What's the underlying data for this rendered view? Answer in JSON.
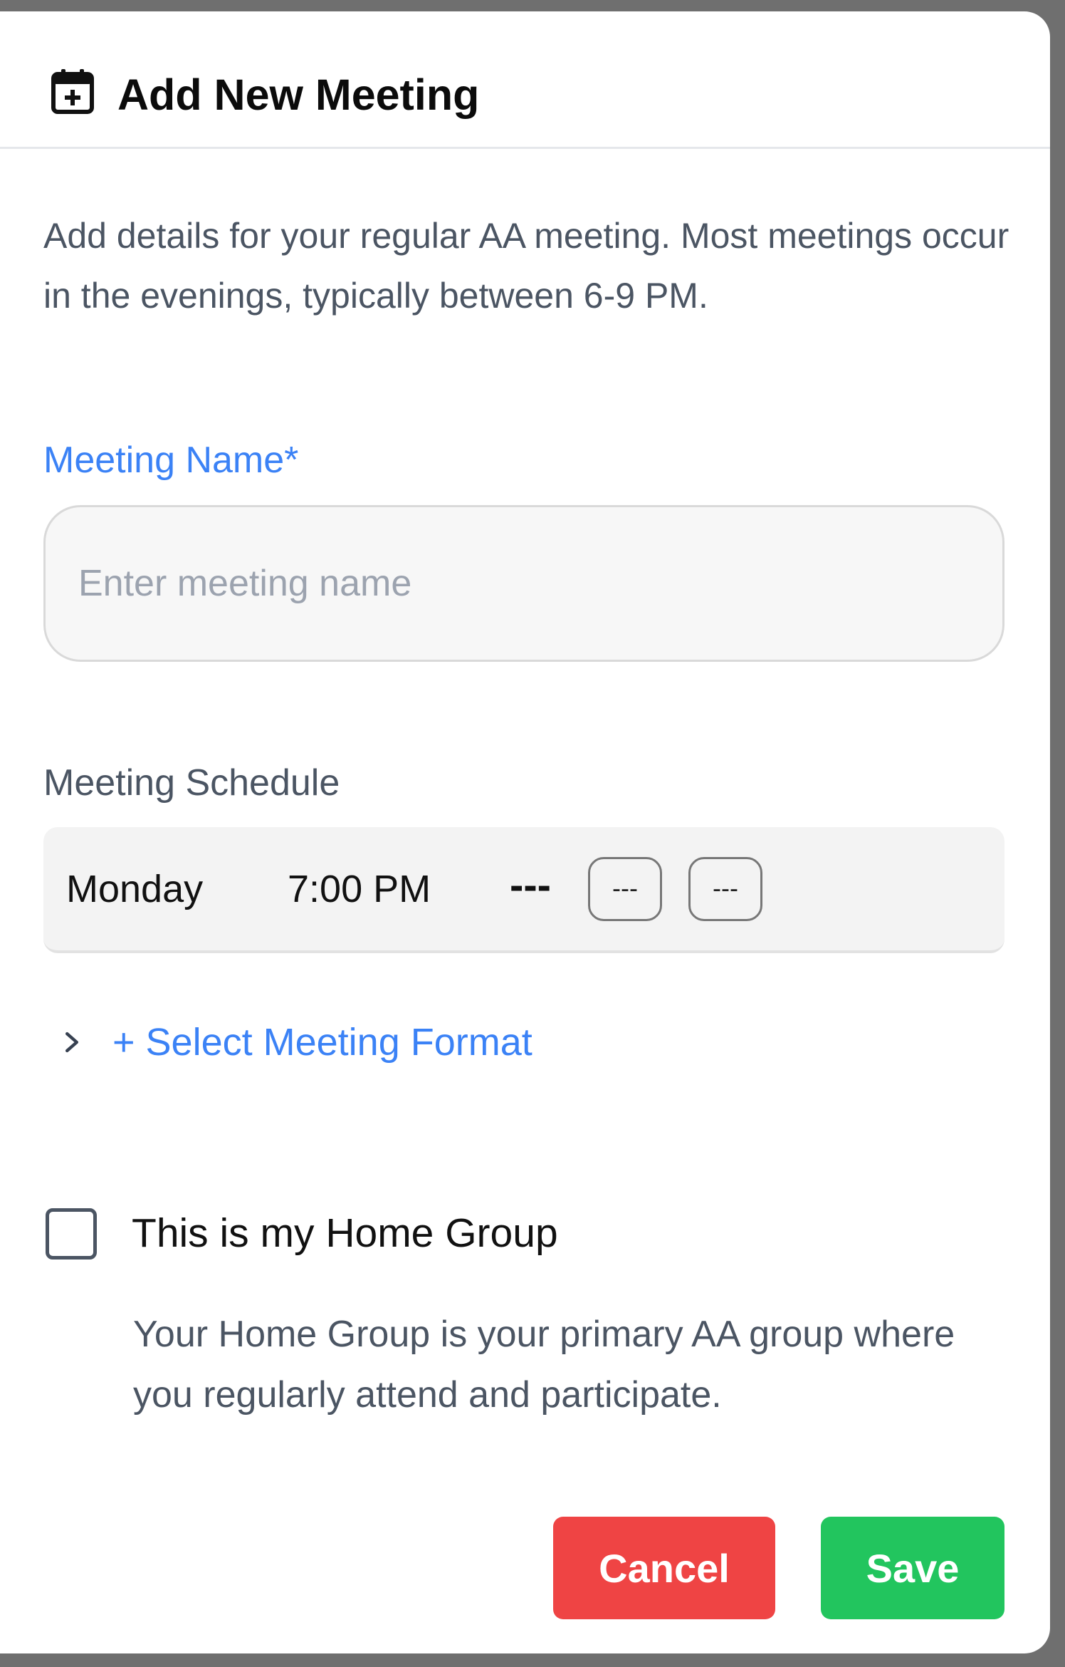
{
  "dialog": {
    "title": "Add New Meeting",
    "icon": "calendar-plus-icon",
    "description": "Add details for your regular AA meeting. Most meetings occur in the evenings, typically between 6-9 PM."
  },
  "meeting_name": {
    "label": "Meeting Name*",
    "placeholder": "Enter meeting name",
    "value": ""
  },
  "schedule": {
    "label": "Meeting Schedule",
    "day": "Monday",
    "time": "7:00 PM",
    "separator": "---",
    "button_1": "---",
    "button_2": "---"
  },
  "format": {
    "label": "+ Select Meeting Format",
    "icon": "chevron-right-icon"
  },
  "home_group": {
    "checked": false,
    "label": "This is my Home Group",
    "description": "Your Home Group is your primary AA group where you regularly attend and participate."
  },
  "actions": {
    "cancel": "Cancel",
    "save": "Save"
  },
  "colors": {
    "accent": "#3b82f6",
    "cancel": "#ef4444",
    "save": "#22c55e"
  }
}
